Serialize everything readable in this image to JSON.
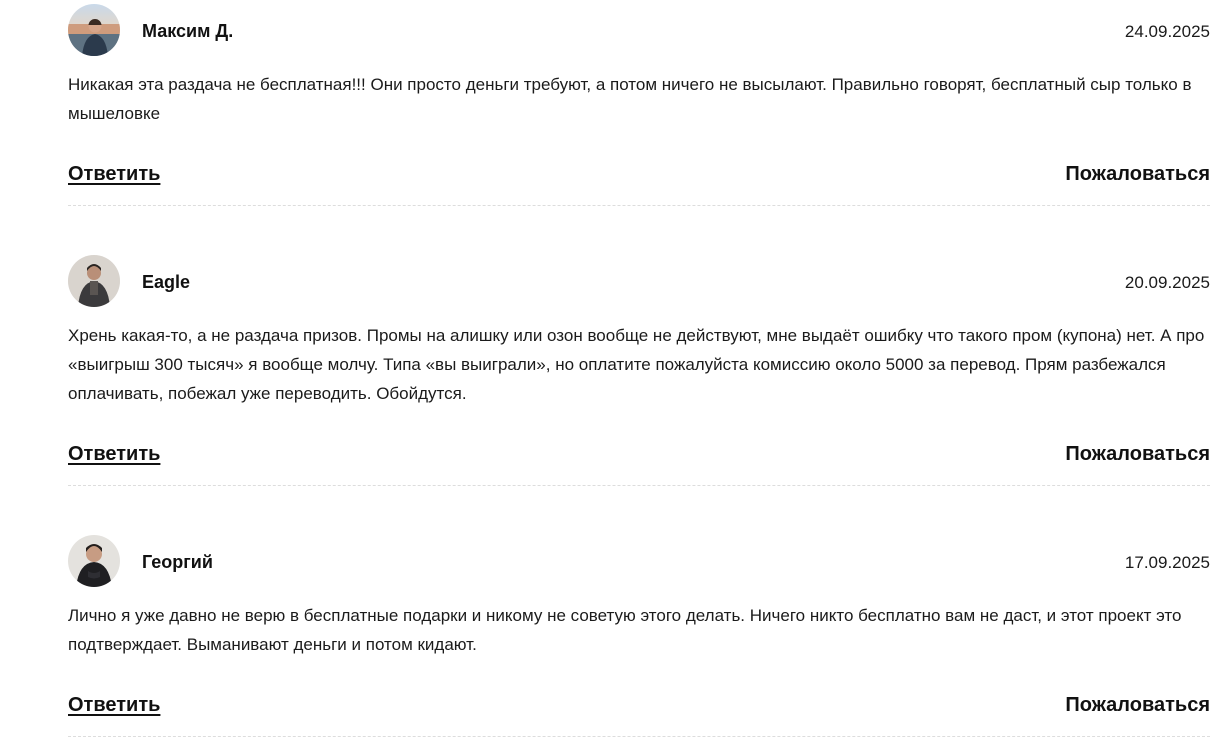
{
  "comments": [
    {
      "author": "Максим Д.",
      "date": "24.09.2025",
      "text": "Никакая эта раздача не бесплатная!!! Они просто деньги требуют, а потом ничего не высылают. Правильно говорят, бесплатный сыр только в мышеловке",
      "reply_label": "Ответить",
      "report_label": "Пожаловаться"
    },
    {
      "author": "Eagle",
      "date": "20.09.2025",
      "text": "Хрень какая-то, а не раздача призов. Промы на алишку или озон вообще не действуют, мне выдаёт ошибку что такого пром (купона) нет. А про «выигрыш 300 тысяч» я вообще молчу. Типа «вы выиграли», но оплатите пожалуйста комиссию около 5000 за перевод. Прям разбежался оплачивать, побежал уже переводить. Обойдутся.",
      "reply_label": "Ответить",
      "report_label": "Пожаловаться"
    },
    {
      "author": "Георгий",
      "date": "17.09.2025",
      "text": "Лично я уже давно не верю в бесплатные подарки и никому не советую этого делать. Ничего никто бесплатно вам не даст, и этот проект это подтверждает. Выманивают деньги и потом кидают.",
      "reply_label": "Ответить",
      "report_label": "Пожаловаться"
    }
  ]
}
